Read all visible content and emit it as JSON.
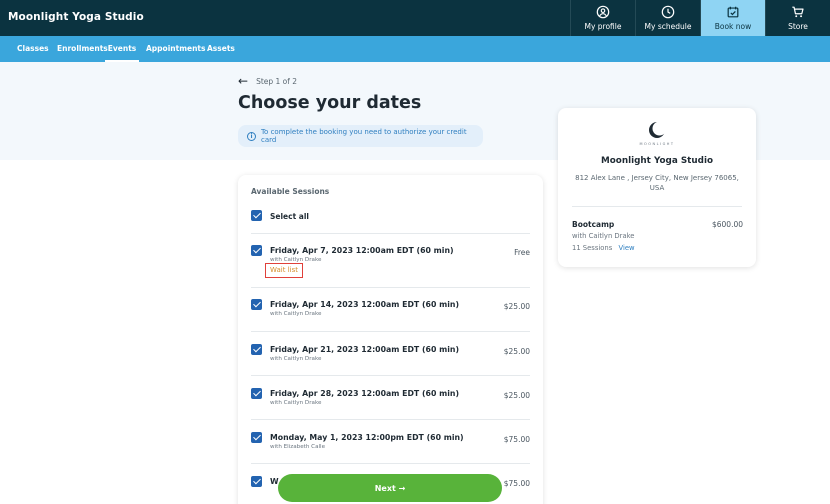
{
  "app": {
    "title": "Moonlight Yoga Studio"
  },
  "top_nav": [
    {
      "label": "My profile",
      "icon": "user-circle-icon"
    },
    {
      "label": "My schedule",
      "icon": "clock-icon"
    },
    {
      "label": "Book now",
      "icon": "calendar-check-icon",
      "active": true
    },
    {
      "label": "Store",
      "icon": "cart-icon"
    }
  ],
  "sub_nav": [
    {
      "label": "Classes"
    },
    {
      "label": "Enrollments"
    },
    {
      "label": "Events",
      "active": true
    },
    {
      "label": "Appointments"
    },
    {
      "label": "Assets"
    }
  ],
  "step": {
    "text": "Step 1 of 2"
  },
  "page_title": "Choose your dates",
  "info": {
    "text": "To complete the booking you need to authorize your credit card"
  },
  "sessions": {
    "heading": "Available Sessions",
    "select_all": "Select all",
    "wait_list_label": "Wait list",
    "items": [
      {
        "title": "Friday, Apr 7, 2023 12:00am EDT (60 min)",
        "instructor": "with Caitlyn Drake",
        "price": "Free"
      },
      {
        "title": "Friday, Apr 14, 2023 12:00am EDT (60 min)",
        "instructor": "with Caitlyn Drake",
        "price": "$25.00"
      },
      {
        "title": "Friday, Apr 21, 2023 12:00am EDT (60 min)",
        "instructor": "with Caitlyn Drake",
        "price": "$25.00"
      },
      {
        "title": "Friday, Apr 28, 2023 12:00am EDT (60 min)",
        "instructor": "with Caitlyn Drake",
        "price": "$25.00"
      },
      {
        "title": "Monday, May 1, 2023 12:00pm EDT (60 min)",
        "instructor": "with Elizabeth Calle",
        "price": "$75.00"
      },
      {
        "title": "W",
        "instructor": "",
        "price": "$75.00"
      }
    ]
  },
  "studio": {
    "logo_text": "MOONLIGHT",
    "name": "Moonlight Yoga Studio",
    "address": "812 Alex Lane , Jersey City, New Jersey 76065, USA",
    "program": "Bootcamp",
    "price": "$600.00",
    "instructor": "with Caitlyn Drake",
    "sessions_count": "11 Sessions",
    "view_label": "View"
  },
  "next_button": {
    "label": "Next →"
  },
  "colors": {
    "header": "#0b3340",
    "subnav": "#3aa6dc",
    "active_tab": "#8fd4f3",
    "next": "#58b33a",
    "checkbox": "#2363b0"
  }
}
